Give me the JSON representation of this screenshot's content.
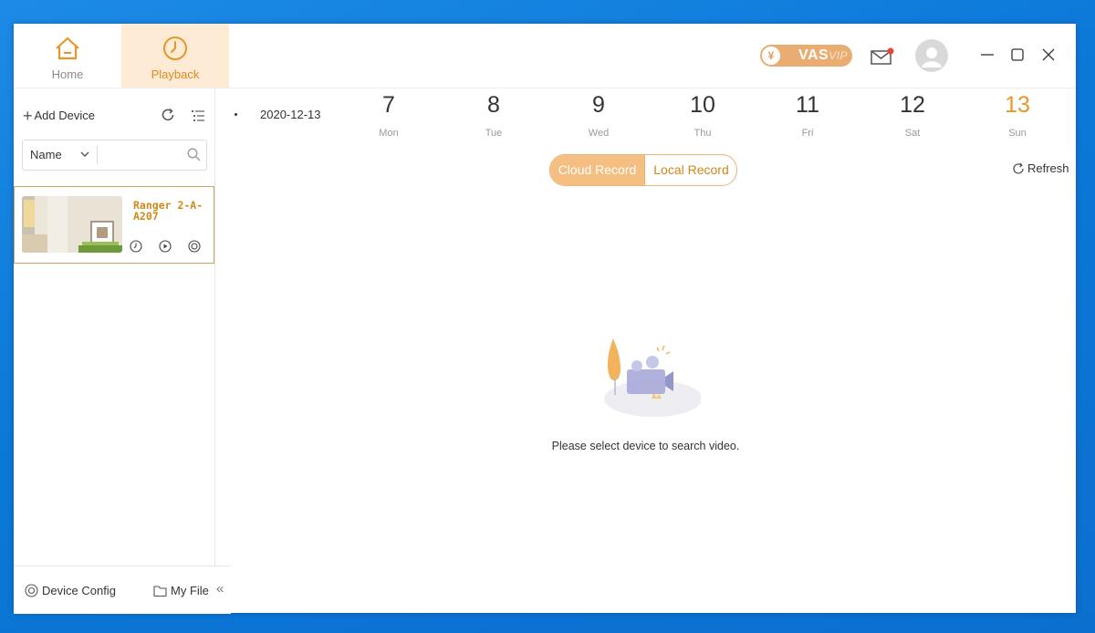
{
  "nav": {
    "home_label": "Home",
    "playback_label": "Playback"
  },
  "header": {
    "vas_symbol": "¥",
    "vas_label": "VAS",
    "vas_vip": "VIP",
    "icons": [
      "home-icon",
      "clock-icon",
      "mail-icon",
      "avatar-icon",
      "minimize-icon",
      "maximize-icon",
      "close-icon"
    ]
  },
  "sidebar": {
    "add_device_label": "Add Device",
    "search": {
      "filter_value": "Name",
      "placeholder": ""
    },
    "devices": [
      {
        "name": "Ranger 2-A-A207"
      }
    ],
    "footer": {
      "device_config_label": "Device Config",
      "my_file_label": "My File",
      "collapse_glyph": "«"
    }
  },
  "main": {
    "current_date": "2020-12-13",
    "days": [
      {
        "num": "7",
        "name": "Mon"
      },
      {
        "num": "8",
        "name": "Tue"
      },
      {
        "num": "9",
        "name": "Wed"
      },
      {
        "num": "10",
        "name": "Thu"
      },
      {
        "num": "11",
        "name": "Fri"
      },
      {
        "num": "12",
        "name": "Sat"
      },
      {
        "num": "13",
        "name": "Sun"
      }
    ],
    "selected_day": "13",
    "cloud_record_label": "Cloud Record",
    "local_record_label": "Local Record",
    "active_record_tab": "Cloud Record",
    "refresh_label": "Refresh",
    "empty_message": "Please select device to search video."
  },
  "colors": {
    "accent": "#e8962a",
    "accent_light": "#fdebd6",
    "desktop": "#0b78d8"
  }
}
